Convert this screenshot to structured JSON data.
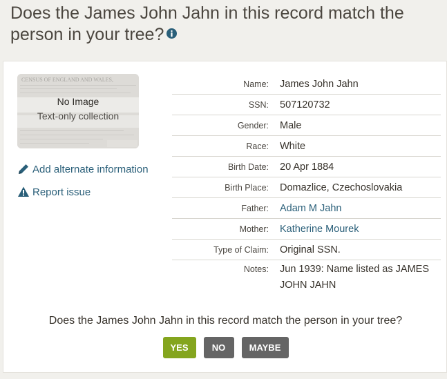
{
  "header": {
    "title": "Does the James John Jahn in this record match the person in your tree?",
    "info_icon": "info-circle-icon"
  },
  "thumbnail": {
    "title": "No Image",
    "subtitle": "Text-only collection",
    "background_text": "CENSUS OF ENGLAND AND WALES,"
  },
  "side_links": [
    {
      "label": "Add alternate information",
      "icon": "pencil-icon"
    },
    {
      "label": "Report issue",
      "icon": "warning-icon"
    }
  ],
  "fields": [
    {
      "label": "Name:",
      "value": "James John Jahn",
      "link": false
    },
    {
      "label": "SSN:",
      "value": "507120732",
      "link": false
    },
    {
      "label": "Gender:",
      "value": "Male",
      "link": false
    },
    {
      "label": "Race:",
      "value": "White",
      "link": false
    },
    {
      "label": "Birth Date:",
      "value": "20 Apr 1884",
      "link": false
    },
    {
      "label": "Birth Place:",
      "value": "Domazlice, Czechoslovakia",
      "link": false
    },
    {
      "label": "Father:",
      "value": "Adam M Jahn",
      "link": true
    },
    {
      "label": "Mother:",
      "value": "Katherine Mourek",
      "link": true
    },
    {
      "label": "Type of Claim:",
      "value": "Original SSN.",
      "link": false
    },
    {
      "label": "Notes:",
      "value": "Jun 1939: Name listed as JAMES JOHN JAHN",
      "link": false
    }
  ],
  "question": "Does the James John Jahn in this record match the person in your tree?",
  "buttons": {
    "yes": "YES",
    "no": "NO",
    "maybe": "MAYBE"
  },
  "colors": {
    "link": "#2a5f79",
    "yes_button": "#84a51e",
    "neutral_button": "#656565",
    "page_background": "#f1f0ec"
  }
}
